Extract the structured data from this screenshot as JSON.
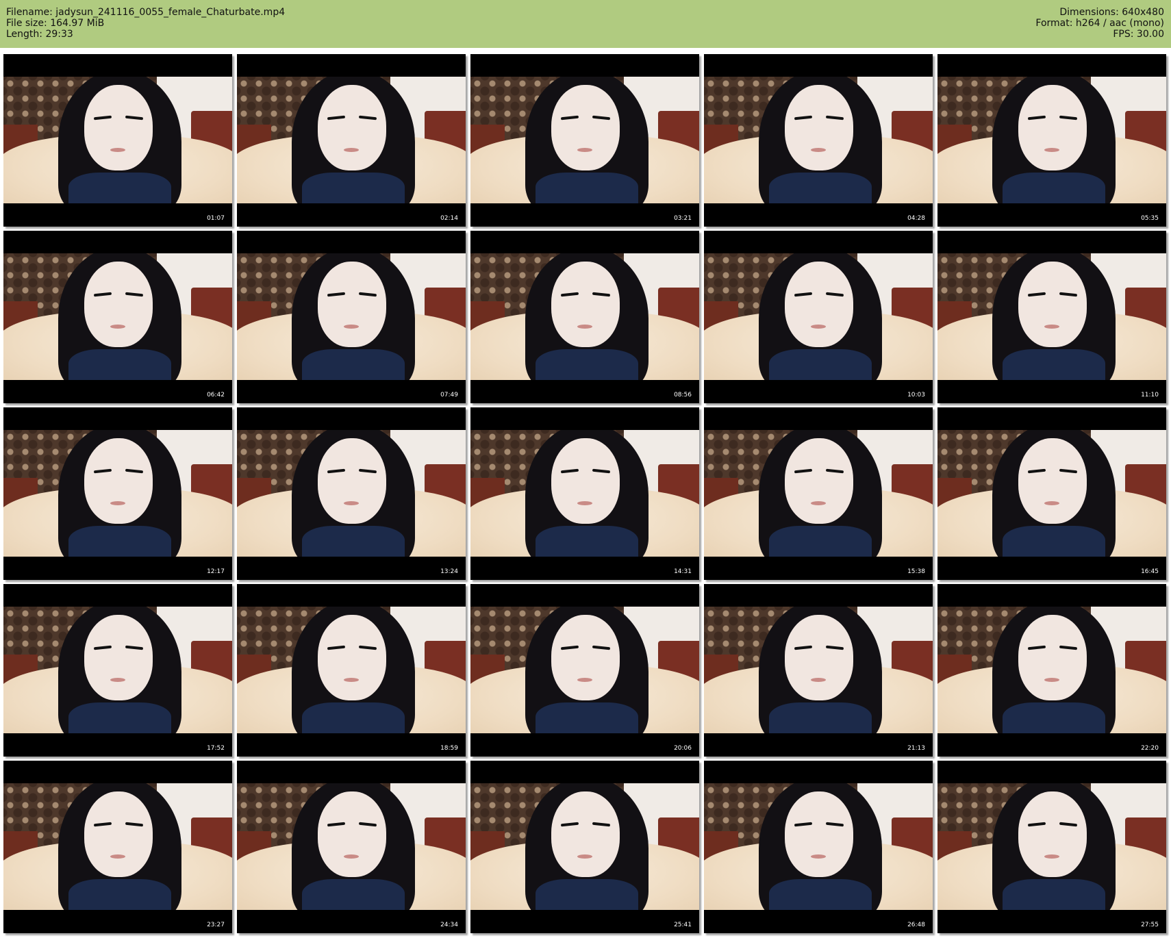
{
  "header": {
    "left": [
      "Filename: jadysun_241116_0055_female_Chaturbate.mp4",
      "File size: 164.97 MiB",
      "Length: 29:33"
    ],
    "right": [
      "Dimensions: 640x480",
      "Format: h264 / aac (mono)",
      "FPS: 30.00"
    ]
  },
  "thumbnails": [
    {
      "time": "01:07"
    },
    {
      "time": "02:14"
    },
    {
      "time": "03:21"
    },
    {
      "time": "04:28"
    },
    {
      "time": "05:35"
    },
    {
      "time": "06:42"
    },
    {
      "time": "07:49"
    },
    {
      "time": "08:56"
    },
    {
      "time": "10:03"
    },
    {
      "time": "11:10"
    },
    {
      "time": "12:17"
    },
    {
      "time": "13:24"
    },
    {
      "time": "14:31"
    },
    {
      "time": "15:38"
    },
    {
      "time": "16:45"
    },
    {
      "time": "17:52"
    },
    {
      "time": "18:59"
    },
    {
      "time": "20:06"
    },
    {
      "time": "21:13"
    },
    {
      "time": "22:20"
    },
    {
      "time": "23:27"
    },
    {
      "time": "24:34"
    },
    {
      "time": "25:41"
    },
    {
      "time": "26:48"
    },
    {
      "time": "27:55"
    }
  ],
  "colors": {
    "header_bg": "#b0cb80",
    "thumb_bg": "#000000",
    "timestamp": "#ffffff"
  }
}
